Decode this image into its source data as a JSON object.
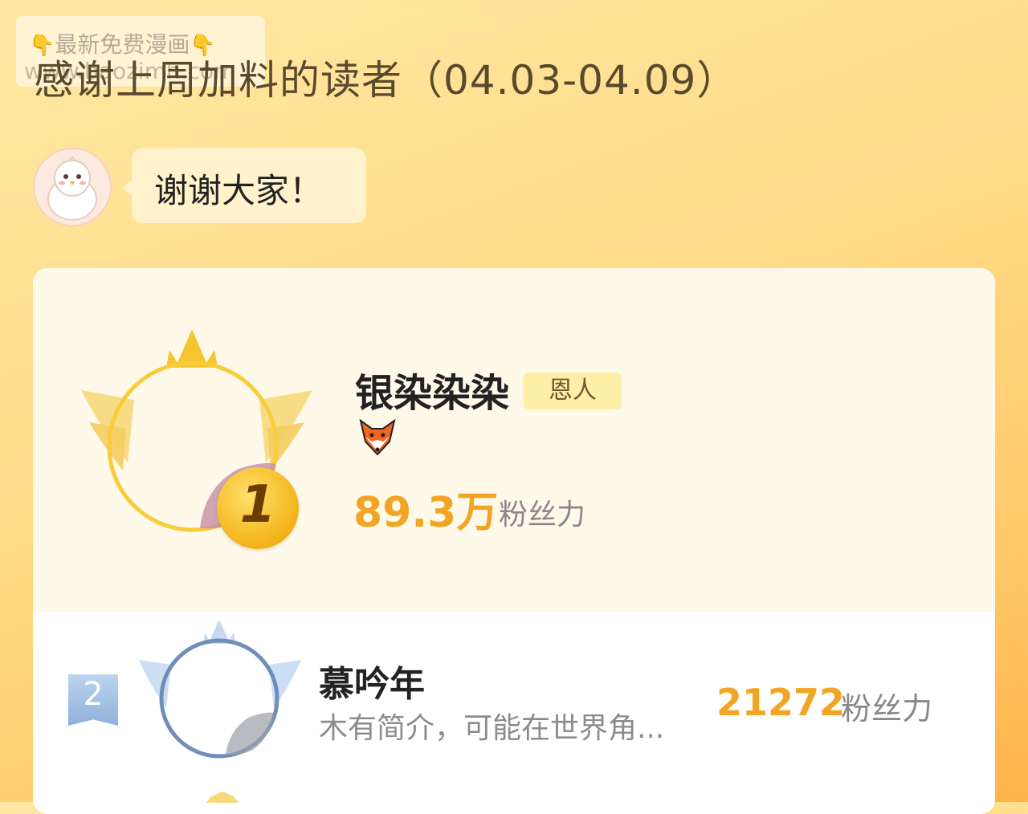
{
  "watermark": {
    "line1": "最新免费漫画",
    "line2": "www.baozimh.com"
  },
  "header": {
    "title": "感谢上周加料的读者（04.03-04.09）"
  },
  "message": {
    "text": "谢谢大家！"
  },
  "ranking": [
    {
      "rank": "1",
      "name": "银染染染",
      "tag": "恩人",
      "badge_icon": "fox-icon",
      "score": "89.3万",
      "score_label": "粉丝力"
    },
    {
      "rank": "2",
      "name": "慕吟年",
      "bio": "木有简介，可能在世界角...",
      "score": "21272",
      "score_label": "粉丝力"
    }
  ],
  "colors": {
    "accent": "#f2a524",
    "gold": "#f6c23a",
    "silver": "#8fb1da"
  }
}
